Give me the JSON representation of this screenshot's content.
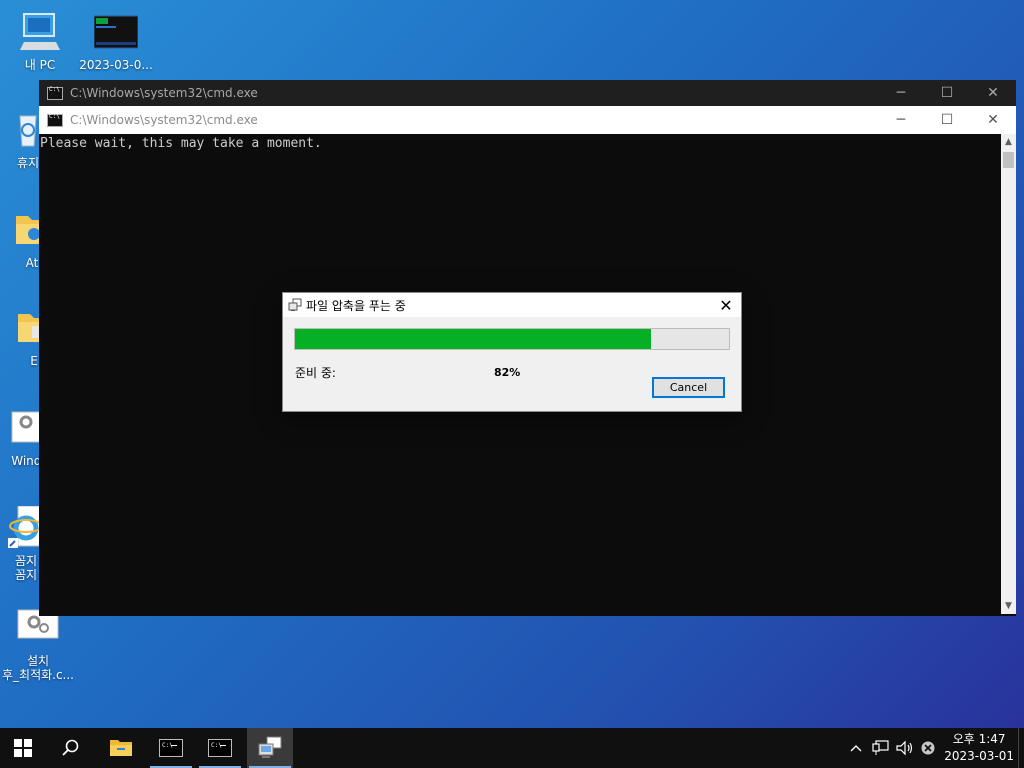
{
  "desktop": {
    "icons": [
      {
        "label": "내 PC",
        "icon": "computer-icon"
      },
      {
        "label": "2023-03-0...",
        "icon": "console-thumbnail-icon"
      },
      {
        "label": "휴지",
        "icon": "recycle-bin-icon"
      },
      {
        "label": "At",
        "icon": "folder-icon"
      },
      {
        "label": "E",
        "icon": "folder-icon"
      },
      {
        "label": "Windo",
        "icon": "settings-file-icon"
      },
      {
        "label": "꼼지\n꼼지",
        "icon": "internet-explorer-icon"
      },
      {
        "label": "설치\n후_최적화.c...",
        "icon": "settings-file-icon"
      }
    ]
  },
  "window_back": {
    "title": "C:\\Windows\\system32\\cmd.exe"
  },
  "window_front": {
    "title": "C:\\Windows\\system32\\cmd.exe",
    "console_text": "Please wait, this may take a moment."
  },
  "window_controls": {
    "minimize": "─",
    "maximize": "☐",
    "close": "✕"
  },
  "dialog": {
    "title": "파일 압축을 푸는 중",
    "progress_percent": 82,
    "status_label": "준비 중:",
    "percent_text": "82%",
    "cancel_label": "Cancel",
    "close_glyph": "✕"
  },
  "taskbar": {
    "items": [
      "start-button",
      "search-button",
      "file-explorer",
      "cmd-window-1",
      "cmd-window-2",
      "extract-app"
    ],
    "tray": {
      "chevron": "^",
      "clock_time": "오후 1:47",
      "clock_date": "2023-03-01"
    }
  },
  "colors": {
    "progress_fill": "#06b025",
    "focus_border": "#0078d7",
    "console_bg": "#0c0c0c"
  }
}
